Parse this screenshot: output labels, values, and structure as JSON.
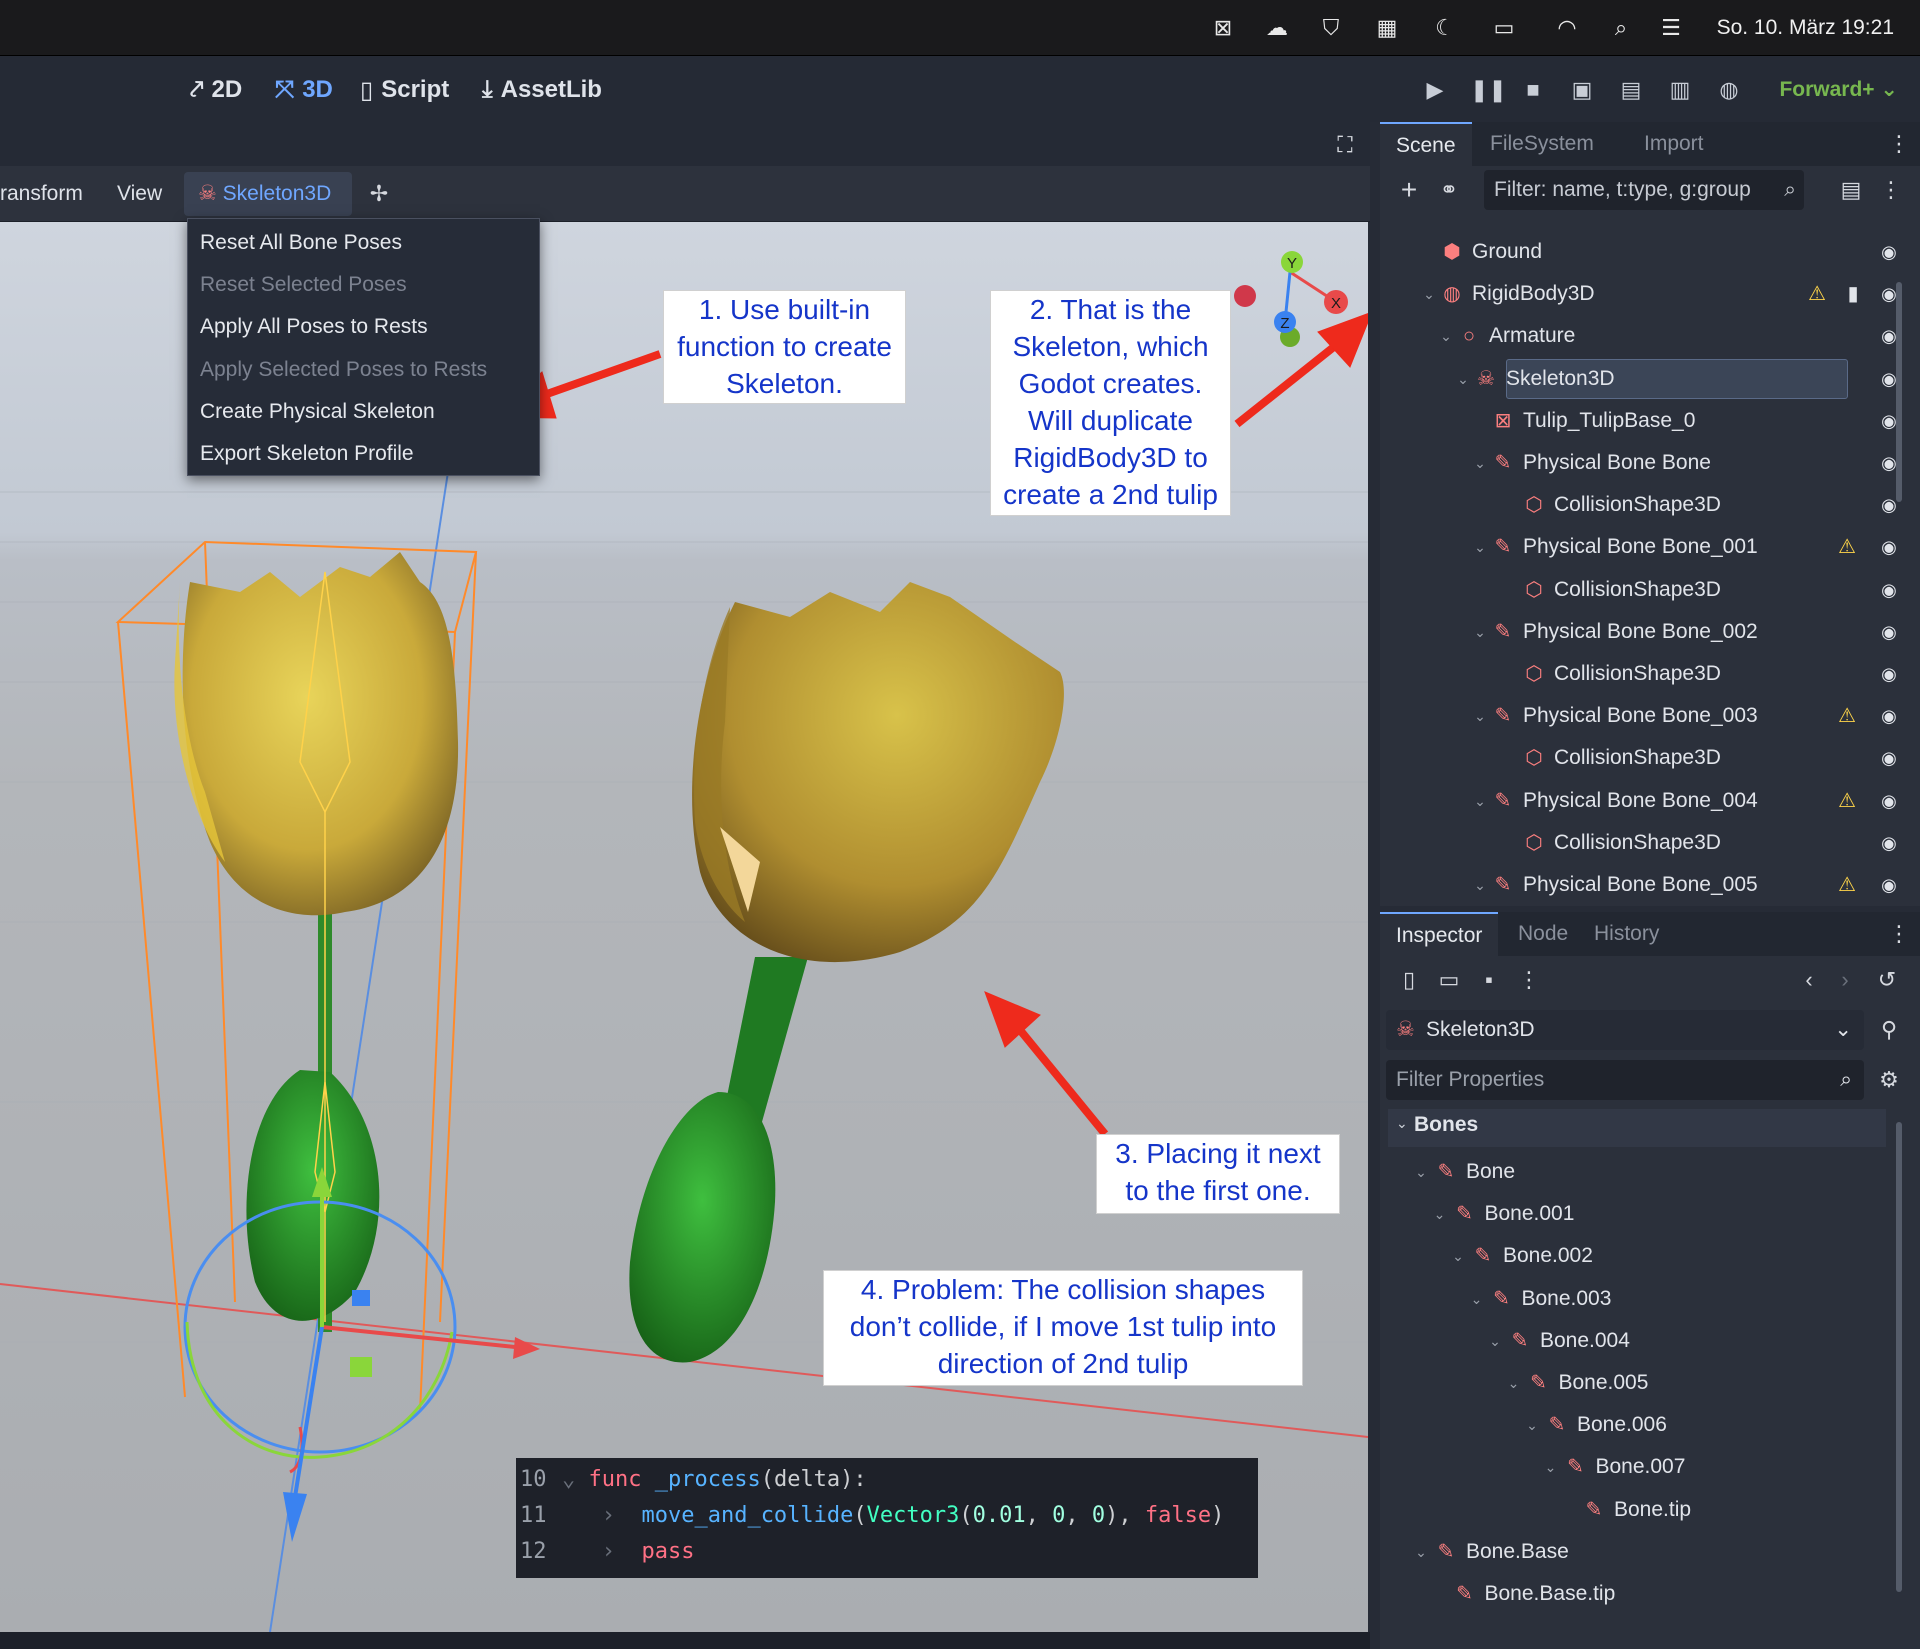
{
  "menubar": {
    "clock": "So. 10. März  19:21"
  },
  "topbar": {
    "workspaces": [
      "2D",
      "3D",
      "Script",
      "AssetLib"
    ],
    "active_workspace": "3D",
    "renderer": "Forward+"
  },
  "viewport_toolbar": {
    "items": [
      "ransform",
      "View"
    ],
    "skeleton_button": "Skeleton3D"
  },
  "skeleton_menu": {
    "items": [
      {
        "label": "Reset All Bone Poses",
        "enabled": true
      },
      {
        "label": "Reset Selected Poses",
        "enabled": false
      },
      {
        "label": "Apply All Poses to Rests",
        "enabled": true
      },
      {
        "label": "Apply Selected Poses to Rests",
        "enabled": false
      },
      {
        "label": "Create Physical Skeleton",
        "enabled": true
      },
      {
        "label": "Export Skeleton Profile",
        "enabled": true
      }
    ]
  },
  "gizmo": {
    "x": "X",
    "y": "Y",
    "z": "Z"
  },
  "callouts": {
    "c1": [
      "1. Use built-in",
      "function to create",
      "Skeleton."
    ],
    "c2": [
      "2. That is the",
      "Skeleton, which",
      "Godot creates.",
      "Will duplicate",
      "RigidBody3D to",
      "create a 2nd tulip"
    ],
    "c3": [
      "3. Placing it next",
      "to the first one."
    ],
    "c4": [
      "4. Problem: The collision shapes",
      "don’t collide, if I move 1st tulip into",
      "direction of 2nd tulip"
    ]
  },
  "code": {
    "lines": [
      {
        "num": "10",
        "parts": [
          [
            "kw",
            "func"
          ],
          [
            "pl",
            " "
          ],
          [
            "fn",
            "_process"
          ],
          [
            "pl",
            "(delta):"
          ]
        ]
      },
      {
        "num": "11",
        "parts": [
          [
            "fn",
            "move_and_collide"
          ],
          [
            "pl",
            "("
          ],
          [
            "ty",
            "Vector3"
          ],
          [
            "pl",
            "("
          ],
          [
            "nm",
            "0.01"
          ],
          [
            "pl",
            ", "
          ],
          [
            "nm",
            "0"
          ],
          [
            "pl",
            ", "
          ],
          [
            "nm",
            "0"
          ],
          [
            "pl",
            "), "
          ],
          [
            "kw",
            "false"
          ],
          [
            "pl",
            ")"
          ]
        ]
      },
      {
        "num": "12",
        "parts": [
          [
            "kw",
            "pass"
          ]
        ]
      }
    ]
  },
  "scene_dock": {
    "tabs": [
      "Scene",
      "FileSystem",
      "Import"
    ],
    "active_tab": "Scene",
    "filter_placeholder": "Filter: name, t:type, g:group",
    "tree": [
      {
        "label": "Ground",
        "depth": 0,
        "icon": "static-body-icon",
        "arrow": false,
        "warn": false
      },
      {
        "label": "RigidBody3D",
        "depth": 0,
        "icon": "rigid-body-icon",
        "arrow": true,
        "warn": true,
        "script": true
      },
      {
        "label": "Armature",
        "depth": 1,
        "icon": "node3d-icon",
        "arrow": true,
        "warn": false
      },
      {
        "label": "Skeleton3D",
        "depth": 2,
        "icon": "skeleton-icon",
        "arrow": true,
        "warn": false,
        "selected": true
      },
      {
        "label": "Tulip_TulipBase_0",
        "depth": 3,
        "icon": "mesh-icon",
        "arrow": false,
        "warn": false
      },
      {
        "label": "Physical Bone Bone",
        "depth": 3,
        "icon": "bone-icon",
        "arrow": true,
        "warn": false
      },
      {
        "label": "CollisionShape3D",
        "depth": 4,
        "icon": "collision-shape-icon",
        "arrow": false,
        "warn": false
      },
      {
        "label": "Physical Bone Bone_001",
        "depth": 3,
        "icon": "bone-icon",
        "arrow": true,
        "warn": true
      },
      {
        "label": "CollisionShape3D",
        "depth": 4,
        "icon": "collision-shape-icon",
        "arrow": false,
        "warn": false
      },
      {
        "label": "Physical Bone Bone_002",
        "depth": 3,
        "icon": "bone-icon",
        "arrow": true,
        "warn": false
      },
      {
        "label": "CollisionShape3D",
        "depth": 4,
        "icon": "collision-shape-icon",
        "arrow": false,
        "warn": false
      },
      {
        "label": "Physical Bone Bone_003",
        "depth": 3,
        "icon": "bone-icon",
        "arrow": true,
        "warn": true
      },
      {
        "label": "CollisionShape3D",
        "depth": 4,
        "icon": "collision-shape-icon",
        "arrow": false,
        "warn": false
      },
      {
        "label": "Physical Bone Bone_004",
        "depth": 3,
        "icon": "bone-icon",
        "arrow": true,
        "warn": true
      },
      {
        "label": "CollisionShape3D",
        "depth": 4,
        "icon": "collision-shape-icon",
        "arrow": false,
        "warn": false
      },
      {
        "label": "Physical Bone Bone_005",
        "depth": 3,
        "icon": "bone-icon",
        "arrow": true,
        "warn": true
      }
    ]
  },
  "inspector": {
    "tabs": [
      "Inspector",
      "Node",
      "History"
    ],
    "active_tab": "Inspector",
    "object": "Skeleton3D",
    "filter_placeholder": "Filter Properties",
    "section": "Bones",
    "bones": [
      {
        "label": "Bone",
        "depth": 0,
        "arrow": true
      },
      {
        "label": "Bone.001",
        "depth": 1,
        "arrow": true
      },
      {
        "label": "Bone.002",
        "depth": 2,
        "arrow": true
      },
      {
        "label": "Bone.003",
        "depth": 3,
        "arrow": true
      },
      {
        "label": "Bone.004",
        "depth": 4,
        "arrow": true
      },
      {
        "label": "Bone.005",
        "depth": 5,
        "arrow": true
      },
      {
        "label": "Bone.006",
        "depth": 6,
        "arrow": true
      },
      {
        "label": "Bone.007",
        "depth": 7,
        "arrow": true
      },
      {
        "label": "Bone.tip",
        "depth": 8,
        "arrow": false
      },
      {
        "label": "Bone.Base",
        "depth": 0,
        "arrow": true
      },
      {
        "label": "Bone.Base.tip",
        "depth": 1,
        "arrow": false
      }
    ]
  },
  "colors": {
    "accent": "#6fa7ff",
    "warn": "#ffd54a",
    "arrow": "#ee2a1c",
    "callout_text": "#1535c9",
    "renderer": "#77b74f"
  }
}
